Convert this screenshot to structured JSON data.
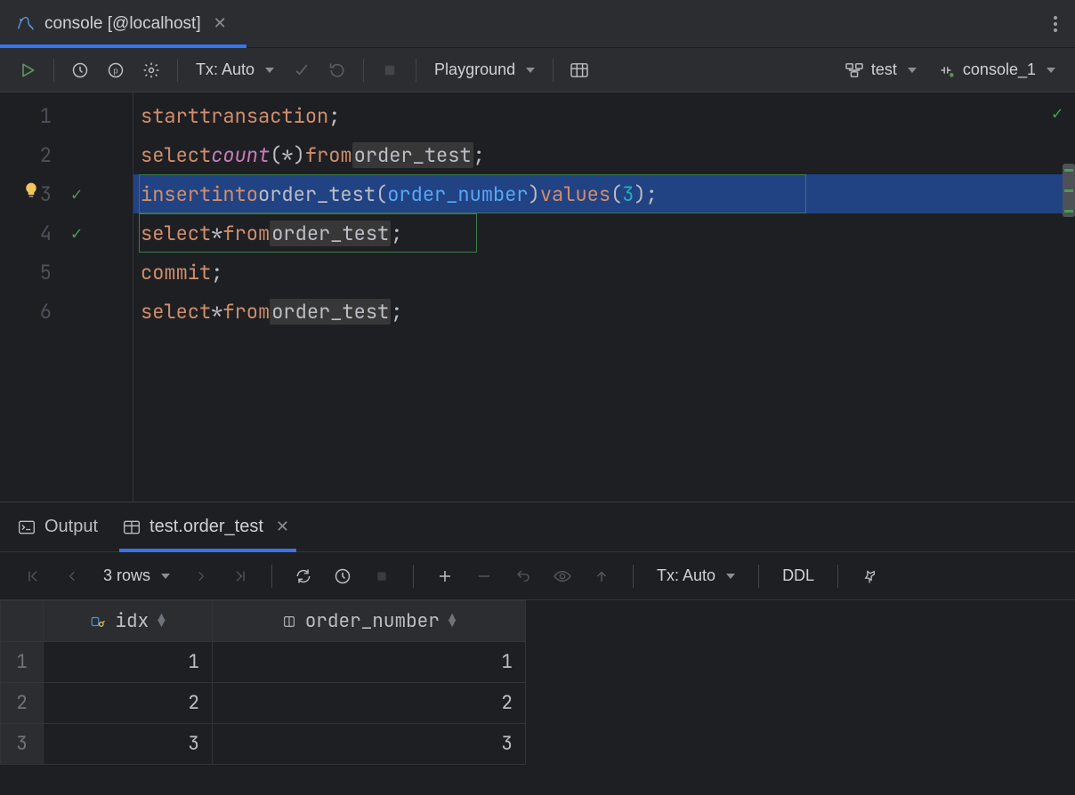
{
  "tab": {
    "title": "console [@localhost]"
  },
  "toolbar": {
    "tx_label": "Tx: Auto",
    "playground_label": "Playground",
    "schema_label": "test",
    "session_label": "console_1"
  },
  "editor": {
    "lines": [
      {
        "n": "1"
      },
      {
        "n": "2"
      },
      {
        "n": "3",
        "check": true
      },
      {
        "n": "4",
        "check": true
      },
      {
        "n": "5"
      },
      {
        "n": "6"
      }
    ],
    "code": {
      "l1": {
        "kw1": "start",
        "kw2": "transaction",
        "semi": ";"
      },
      "l2": {
        "kw1": "select",
        "fn": "count",
        "lp": "(",
        "star": "*",
        "rp": ")",
        "kw2": "from",
        "tbl": "order_test",
        "semi": ";"
      },
      "l3": {
        "kw1": "insert",
        "kw2": "into",
        "tbl": "order_test",
        "lp": "(",
        "col": "order_number",
        "rp": ")",
        "kw3": "values",
        "lp2": "(",
        "num": "3",
        "rp2": ")",
        "semi": ";"
      },
      "l4": {
        "kw1": "select",
        "star": "*",
        "kw2": "from",
        "tbl": "order_test",
        "semi": ";"
      },
      "l5": {
        "kw1": "commit",
        "semi": ";"
      },
      "l6": {
        "kw1": "select",
        "star": "*",
        "kw2": "from",
        "tbl": "order_test",
        "semi": ";"
      }
    }
  },
  "panel": {
    "output_label": "Output",
    "result_tab_label": "test.order_test",
    "rows_label": "3 rows",
    "tx_label": "Tx: Auto",
    "ddl_label": "DDL"
  },
  "result": {
    "columns": {
      "idx": "idx",
      "order_number": "order_number"
    },
    "rows": [
      {
        "n": "1",
        "idx": "1",
        "order_number": "1"
      },
      {
        "n": "2",
        "idx": "2",
        "order_number": "2"
      },
      {
        "n": "3",
        "idx": "3",
        "order_number": "3"
      }
    ]
  }
}
